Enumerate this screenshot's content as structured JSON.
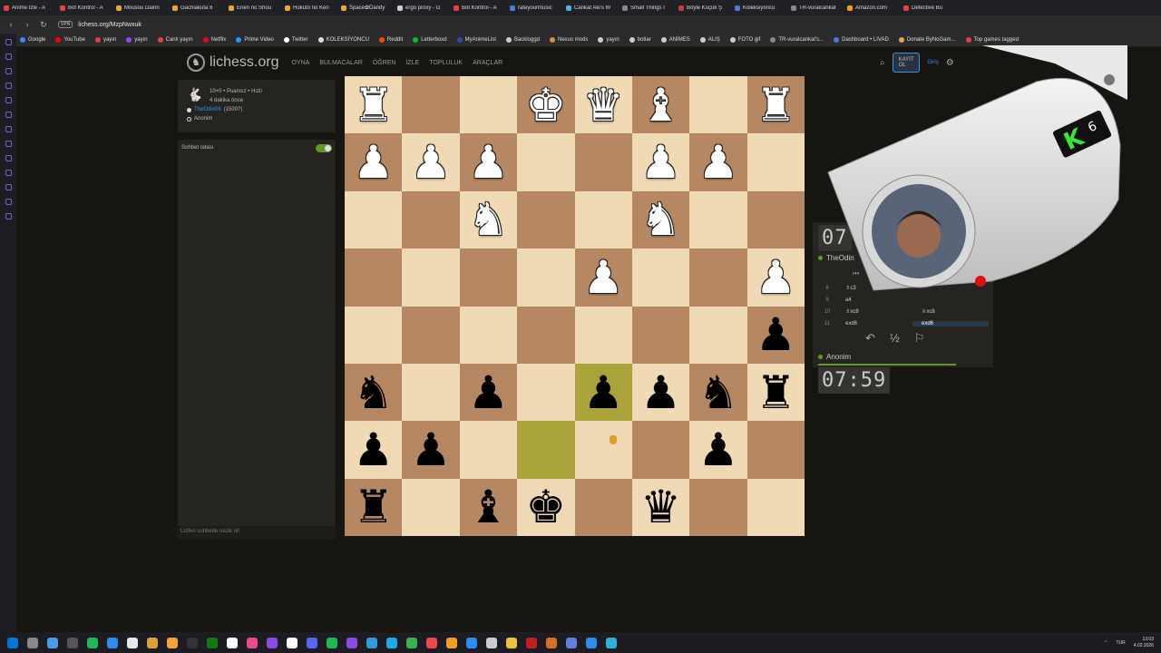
{
  "browser": {
    "tabs": [
      {
        "label": "Anime İzle - A",
        "color": "#e5423b"
      },
      {
        "label": "Bot Kontrol - A",
        "color": "#e5423b"
      },
      {
        "label": "Mousou Dairin",
        "color": "#f4a338"
      },
      {
        "label": "Gachiakuta 8",
        "color": "#f4a338"
      },
      {
        "label": "Enen no Shou",
        "color": "#f4a338"
      },
      {
        "label": "Hokuto no Ken",
        "color": "#f4a338"
      },
      {
        "label": "Space✿Dandy",
        "color": "#f4a338"
      },
      {
        "label": "ergo proxy - G",
        "color": "#cccccc"
      },
      {
        "label": "Bot Kontrol - A",
        "color": "#e5423b"
      },
      {
        "label": "rateyourmusic",
        "color": "#4a7cd8"
      },
      {
        "label": "Cankat Aki's W",
        "color": "#4ab4e5"
      },
      {
        "label": "Small Things I",
        "color": "#888888"
      },
      {
        "label": "Böyle Küçük Ş",
        "color": "#c23b3b"
      },
      {
        "label": "Koleksiyoncu",
        "color": "#4a7cd8"
      },
      {
        "label": "TR-vuralcankat",
        "color": "#888888"
      },
      {
        "label": "Amazon.com",
        "color": "#f29b1c"
      },
      {
        "label": "Detective Bu",
        "color": "#e5423b"
      }
    ],
    "url": "lichess.org/MzpNwxuk",
    "vpn_label": "VPN",
    "bookmarks": [
      {
        "label": "Google",
        "color": "#4285f4"
      },
      {
        "label": "YouTube",
        "color": "#ff0000"
      },
      {
        "label": "yayın",
        "color": "#e5423b"
      },
      {
        "label": "yayın",
        "color": "#9146ff"
      },
      {
        "label": "Canlı yayın",
        "color": "#e5423b"
      },
      {
        "label": "Netflix",
        "color": "#e50914"
      },
      {
        "label": "Prime Video",
        "color": "#1a98ff"
      },
      {
        "label": "Twitter",
        "color": "#ffffff"
      },
      {
        "label": "KOLEKSİYONCU",
        "color": "#dddddd"
      },
      {
        "label": "Reddit",
        "color": "#ff4500"
      },
      {
        "label": "Letterboxd",
        "color": "#00c030"
      },
      {
        "label": "MyAnimeList",
        "color": "#2e51a2"
      },
      {
        "label": "Backloggd",
        "color": "#cccccc"
      },
      {
        "label": "Nexus mods",
        "color": "#d98f40"
      },
      {
        "label": "yayın",
        "color": "#cccccc"
      },
      {
        "label": "botlar",
        "color": "#cccccc"
      },
      {
        "label": "ANİMES",
        "color": "#cccccc"
      },
      {
        "label": "ALIŞ",
        "color": "#cccccc"
      },
      {
        "label": "FOTO gif",
        "color": "#cccccc"
      },
      {
        "label": "TR-vuralcankat's...",
        "color": "#888888"
      },
      {
        "label": "Dashboard • LIVAD",
        "color": "#4a7cd8"
      },
      {
        "label": "Donate ByNoGam...",
        "color": "#f4a338"
      },
      {
        "label": "Top games tagged",
        "color": "#e5423b"
      }
    ]
  },
  "site": {
    "logo": "lichess.org",
    "nav": [
      "OYNA",
      "BULMACALAR",
      "ÖĞREN",
      "İZLE",
      "TOPLULUK",
      "ARAÇLAR"
    ],
    "register": "KAYIT OL",
    "login": "Giriş"
  },
  "game": {
    "title": "10+0 • Puansız • Hızlı",
    "time_ago": "4 dakika önce",
    "player_white": "TheOdin06",
    "player_white_rating": "(1500?)",
    "player_black": "Anonim"
  },
  "chat": {
    "title": "Sohbet odası",
    "enabled": true,
    "placeholder": "Lütfen sohbette nazik ol!"
  },
  "board": {
    "orientation": "black",
    "highlight_squares": [
      "d7",
      "e6"
    ],
    "rows": [
      [
        {
          "p": "R",
          "c": "w"
        },
        null,
        null,
        {
          "p": "K",
          "c": "w"
        },
        {
          "p": "Q",
          "c": "w"
        },
        {
          "p": "B",
          "c": "w"
        },
        null,
        {
          "p": "R",
          "c": "w"
        }
      ],
      [
        {
          "p": "P",
          "c": "w"
        },
        {
          "p": "P",
          "c": "w"
        },
        {
          "p": "P",
          "c": "w"
        },
        null,
        null,
        {
          "p": "P",
          "c": "w"
        },
        {
          "p": "P",
          "c": "w"
        },
        null
      ],
      [
        null,
        null,
        {
          "p": "N",
          "c": "w"
        },
        null,
        null,
        {
          "p": "N",
          "c": "w"
        },
        null,
        null
      ],
      [
        null,
        null,
        null,
        null,
        {
          "p": "P",
          "c": "w"
        },
        null,
        null,
        {
          "p": "P",
          "c": "w"
        }
      ],
      [
        null,
        null,
        null,
        null,
        null,
        null,
        null,
        {
          "p": "P",
          "c": "b"
        }
      ],
      [
        {
          "p": "N",
          "c": "b"
        },
        null,
        {
          "p": "P",
          "c": "b"
        },
        null,
        {
          "p": "P",
          "c": "b"
        },
        {
          "p": "P",
          "c": "b"
        },
        {
          "p": "N",
          "c": "b"
        },
        {
          "p": "R",
          "c": "b"
        }
      ],
      [
        {
          "p": "P",
          "c": "b"
        },
        {
          "p": "P",
          "c": "b"
        },
        null,
        null,
        null,
        null,
        {
          "p": "P",
          "c": "b"
        },
        null
      ],
      [
        {
          "p": "R",
          "c": "b"
        },
        null,
        {
          "p": "B",
          "c": "b"
        },
        {
          "p": "K",
          "c": "b"
        },
        null,
        {
          "p": "Q",
          "c": "b"
        },
        null,
        null
      ]
    ],
    "highlight_cells": [
      [
        5,
        4
      ],
      [
        6,
        3
      ]
    ]
  },
  "panel": {
    "top_clock": "07",
    "top_player": "TheOdin",
    "bottom_clock": "07:59",
    "bottom_player": "Anonim",
    "moves": [
      {
        "n": "8",
        "w": "♗c3",
        "b": ""
      },
      {
        "n": "9",
        "w": "a4",
        "b": ""
      },
      {
        "n": "10",
        "w": "♗xc8",
        "b": "♕xc8"
      },
      {
        "n": "11",
        "w": "exd6",
        "b": "exd6"
      }
    ],
    "draw_symbol": "½"
  },
  "overlay": {
    "badge": "K",
    "badge_number": "6"
  },
  "taskbar": {
    "lang": "TUR",
    "time": "13:03",
    "date": "4.02.2026",
    "icon_colors": [
      "#0078d4",
      "#888888",
      "#4a9be8",
      "#555555",
      "#1db954",
      "#2d8cf0",
      "#e8e8e8",
      "#d9a03b",
      "#f4a338",
      "#333333",
      "#107c10",
      "#ffffff",
      "#e84a8a",
      "#8a4ae8",
      "#ffffff",
      "#5865f2",
      "#1db954",
      "#8a4ae8",
      "#2d9cdb",
      "#21a8e8",
      "#37b24d",
      "#e84a4a",
      "#f0a020",
      "#2d8cf0",
      "#cccccc",
      "#f0c040",
      "#c02020",
      "#d97020",
      "#6080e0",
      "#2d8cf0",
      "#31b0d5"
    ]
  }
}
